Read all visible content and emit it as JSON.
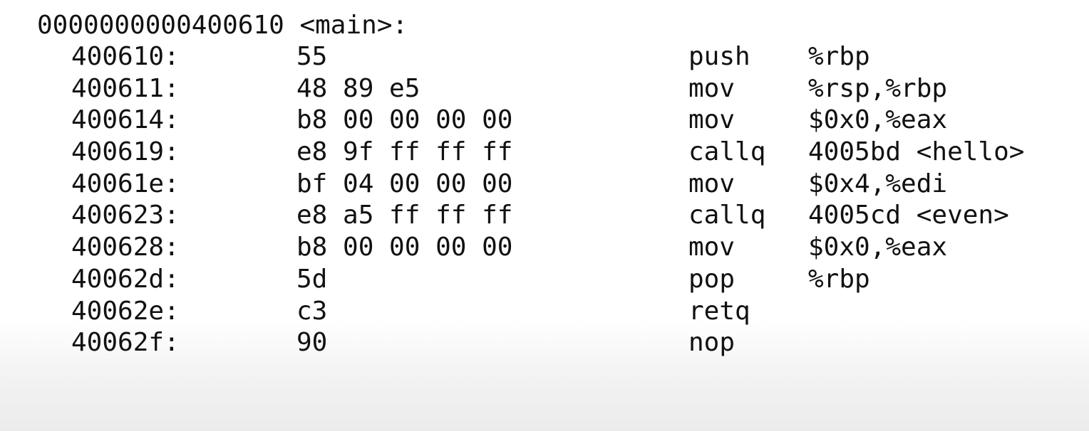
{
  "header": "0000000000400610 <main>:",
  "rows": [
    {
      "addr": "400610:",
      "bytes": "55",
      "mnemonic": "push",
      "operands": "%rbp"
    },
    {
      "addr": "400611:",
      "bytes": "48 89 e5",
      "mnemonic": "mov",
      "operands": "%rsp,%rbp"
    },
    {
      "addr": "400614:",
      "bytes": "b8 00 00 00 00",
      "mnemonic": "mov",
      "operands": "$0x0,%eax"
    },
    {
      "addr": "400619:",
      "bytes": "e8 9f ff ff ff",
      "mnemonic": "callq",
      "operands": "4005bd <hello>"
    },
    {
      "addr": "40061e:",
      "bytes": "bf 04 00 00 00",
      "mnemonic": "mov",
      "operands": "$0x4,%edi"
    },
    {
      "addr": "400623:",
      "bytes": "e8 a5 ff ff ff",
      "mnemonic": "callq",
      "operands": "4005cd <even>"
    },
    {
      "addr": "400628:",
      "bytes": "b8 00 00 00 00",
      "mnemonic": "mov",
      "operands": "$0x0,%eax"
    },
    {
      "addr": "40062d:",
      "bytes": "5d",
      "mnemonic": "pop",
      "operands": "%rbp"
    },
    {
      "addr": "40062e:",
      "bytes": "c3",
      "mnemonic": "retq",
      "operands": ""
    },
    {
      "addr": "40062f:",
      "bytes": "90",
      "mnemonic": "nop",
      "operands": ""
    }
  ]
}
